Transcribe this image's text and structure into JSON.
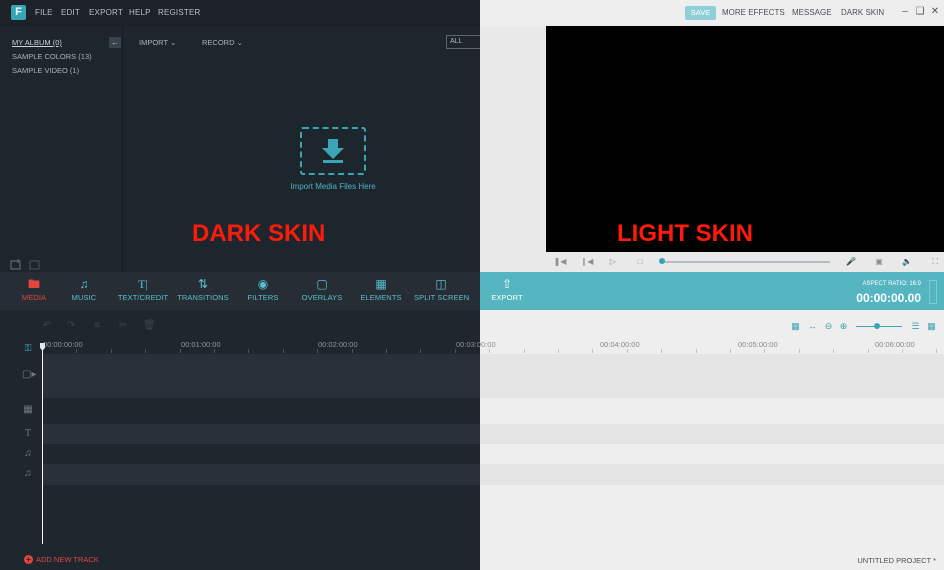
{
  "titlebar": {
    "logo": "F",
    "menu": [
      "FILE",
      "EDIT",
      "EXPORT",
      "HELP",
      "REGISTER"
    ],
    "save_label": "SAVE",
    "right_menu": [
      "MORE EFFECTS",
      "MESSAGE",
      "DARK SKIN"
    ],
    "window_controls": [
      "minimize-icon",
      "restore-icon",
      "close-icon"
    ]
  },
  "library": {
    "albums": [
      "MY ALBUM (0)",
      "SAMPLE COLORS (13)",
      "SAMPLE VIDEO (1)"
    ],
    "import_dropdown": "IMPORT",
    "record_dropdown": "RECORD",
    "filter_value": "ALL",
    "import_hint": "Import Media Files Here"
  },
  "overlay": {
    "dark_label": "DARK SKIN",
    "light_label": "LIGHT SKIN"
  },
  "toolbar": {
    "tools": [
      {
        "label": "MEDIA",
        "icon": "folder-icon"
      },
      {
        "label": "MUSIC",
        "icon": "music-note-icon"
      },
      {
        "label": "TEXT/CREDIT",
        "icon": "text-icon"
      },
      {
        "label": "TRANSITIONS",
        "icon": "transitions-icon"
      },
      {
        "label": "FILTERS",
        "icon": "filters-icon"
      },
      {
        "label": "OVERLAYS",
        "icon": "overlays-icon"
      },
      {
        "label": "ELEMENTS",
        "icon": "image-icon"
      },
      {
        "label": "SPLIT SCREEN",
        "icon": "split-screen-icon"
      },
      {
        "label": "EXPORT",
        "icon": "export-icon"
      }
    ],
    "aspect_ratio": "ASPECT RATIO: 16:9",
    "timecode": "00:00:00.00"
  },
  "timeline": {
    "times": [
      "00:00:00:00",
      "00:01:00:00",
      "00:02:00:00",
      "00:03:00:00",
      "00:04:00:00",
      "00:05:00:00",
      "00:06:00:00"
    ],
    "add_track": "ADD NEW TRACK",
    "project_name": "UNTITLED PROJECT *"
  },
  "colors": {
    "accent": "#3aa5b5",
    "dark_bg": "#1e262d",
    "light_bg": "#eeeeee",
    "label_red": "#ff1a0a"
  }
}
